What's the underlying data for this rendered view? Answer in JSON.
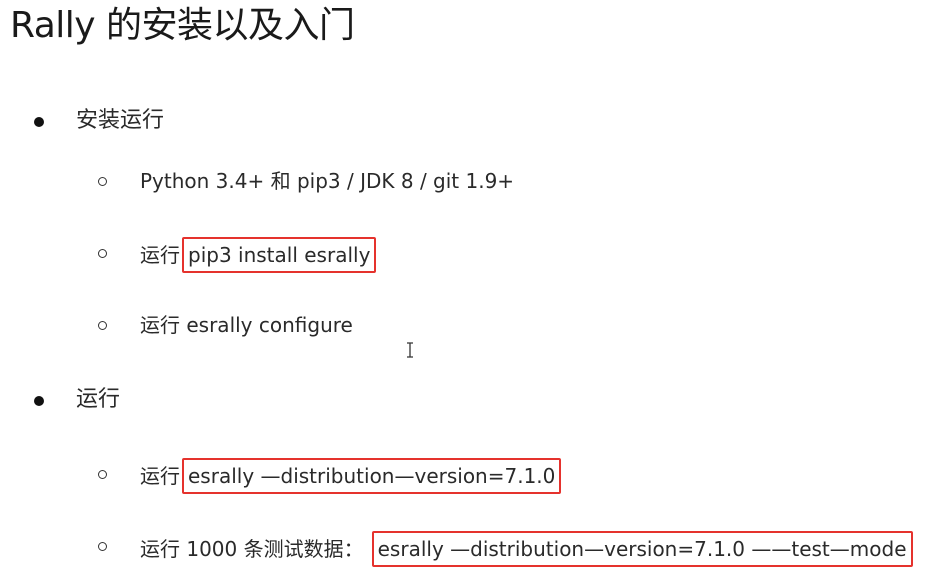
{
  "slide": {
    "title": "Rally 的安装以及入门",
    "sections": [
      {
        "heading": "安装运行",
        "items": [
          {
            "prefix": "",
            "text": "Python 3.4+ 和 pip3  / JDK 8  / git 1.9+"
          },
          {
            "prefix": "运行",
            "code": "pip3 install esrally"
          },
          {
            "prefix": "运行",
            "text": "esrally configure"
          }
        ]
      },
      {
        "heading": "运行",
        "items": [
          {
            "prefix": "运行",
            "code": "esrally —distribution—version=7.1.0"
          },
          {
            "prefix": "运行 1000 条测试数据：",
            "code": "esrally —distribution—version=7.1.0 ——test—mode"
          }
        ]
      }
    ]
  },
  "colors": {
    "highlight_border": "#e5322d"
  },
  "icons": {
    "cursor": "text-cursor-icon"
  }
}
